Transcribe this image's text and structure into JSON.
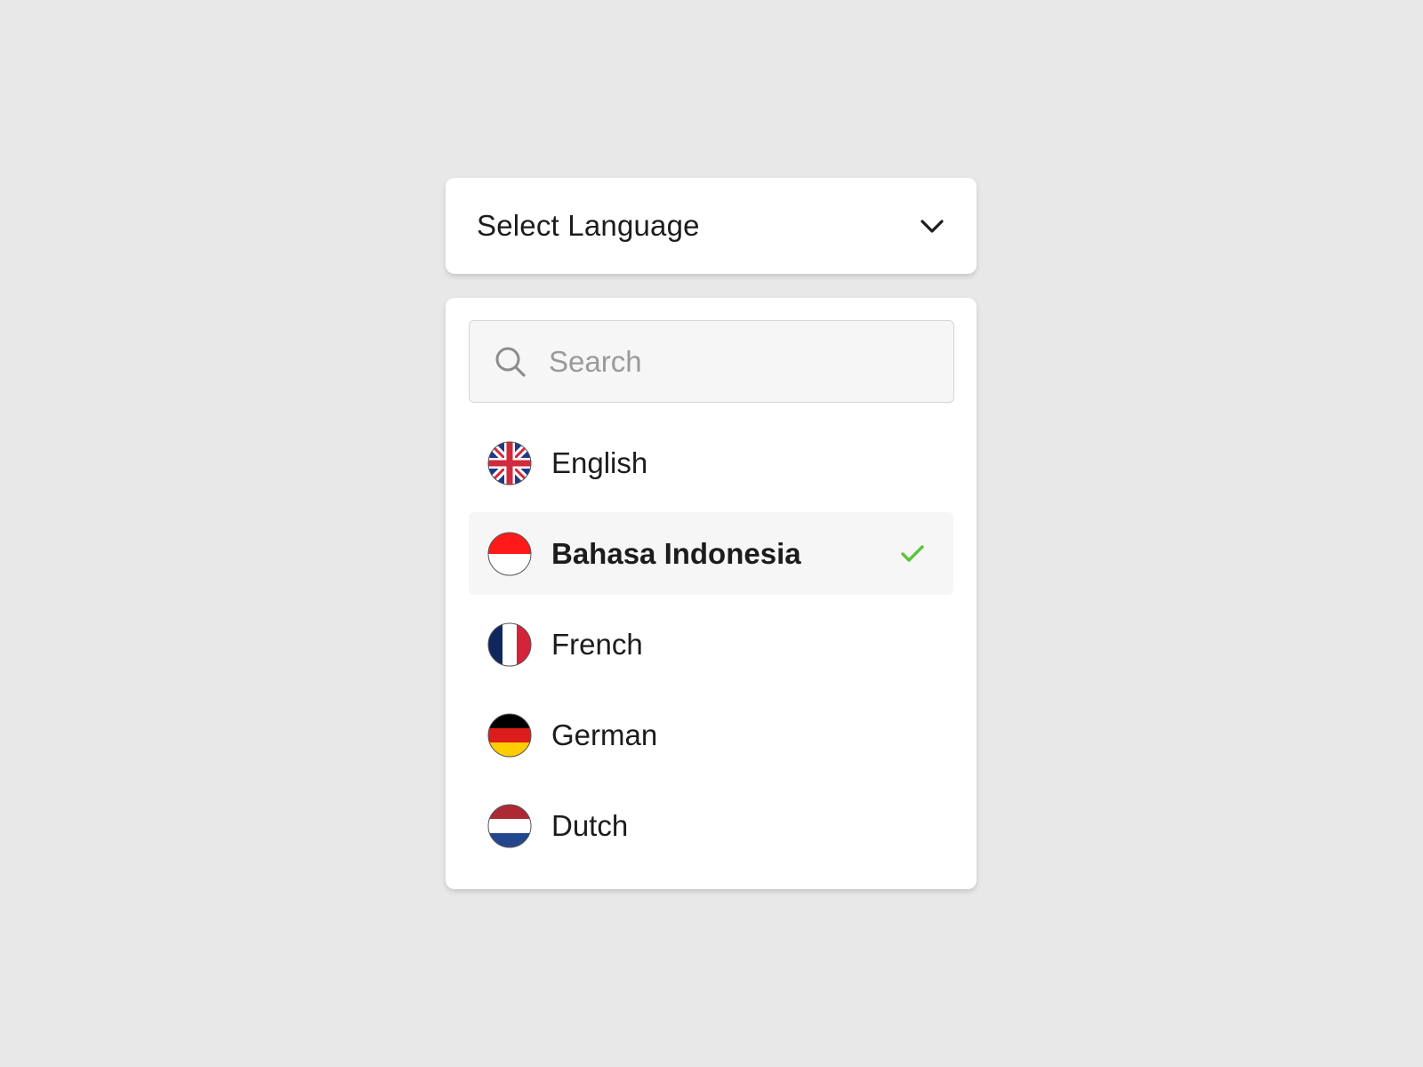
{
  "select": {
    "label": "Select Language",
    "icon": "chevron-down-icon"
  },
  "search": {
    "placeholder": "Search",
    "value": "",
    "icon": "search-icon"
  },
  "languages": [
    {
      "name": "English",
      "flag": "uk-flag-icon",
      "selected": false
    },
    {
      "name": "Bahasa Indonesia",
      "flag": "indonesia-flag-icon",
      "selected": true
    },
    {
      "name": "French",
      "flag": "france-flag-icon",
      "selected": false
    },
    {
      "name": "German",
      "flag": "germany-flag-icon",
      "selected": false
    },
    {
      "name": "Dutch",
      "flag": "netherlands-flag-icon",
      "selected": false
    }
  ],
  "colors": {
    "background": "#e8e8e8",
    "surface": "#ffffff",
    "selected_row": "#f6f6f6",
    "check": "#5cc43c",
    "placeholder": "#9a9a9a",
    "text": "#1c1c1c"
  }
}
